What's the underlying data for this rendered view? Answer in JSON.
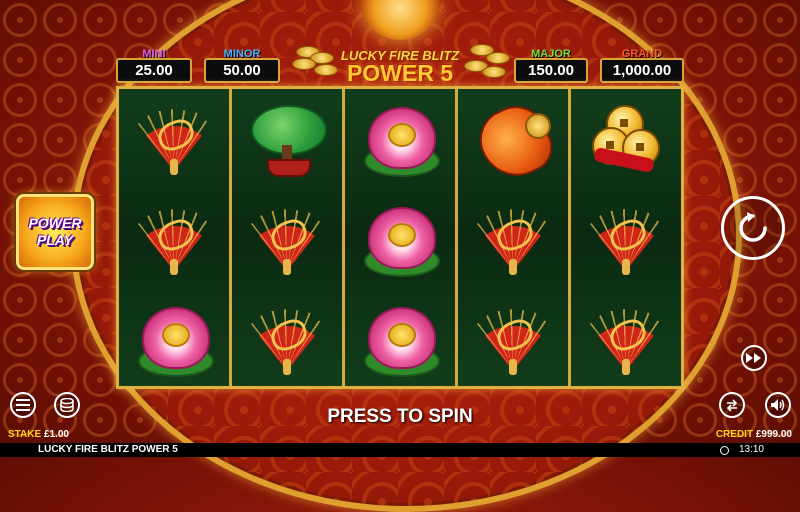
{
  "game": {
    "title": "LUCKY FIRE BLITZ POWER 5",
    "logo_line1": "LUCKY FIRE BLITZ",
    "logo_line2": "POWER 5"
  },
  "jackpots": [
    {
      "name": "MINI",
      "value": "25.00",
      "color": "#e85ae8"
    },
    {
      "name": "MINOR",
      "value": "50.00",
      "color": "#4ab0ff"
    },
    {
      "name": "MAJOR",
      "value": "150.00",
      "color": "#7ae03a"
    },
    {
      "name": "GRAND",
      "value": "1,000.00",
      "color": "#ff5a2a"
    }
  ],
  "reels": [
    [
      "fan",
      "fan",
      "lotus"
    ],
    [
      "money-tree",
      "fan",
      "fan"
    ],
    [
      "lotus",
      "lotus",
      "lotus"
    ],
    [
      "koi-fish",
      "fan",
      "fan"
    ],
    [
      "gold-coins",
      "fan",
      "fan"
    ]
  ],
  "power_play": {
    "line1": "POWER",
    "line2": "PLAY"
  },
  "spin_prompt": "PRESS TO SPIN",
  "stake": {
    "label": "STAKE",
    "value": "£1.00"
  },
  "credit": {
    "label": "CREDIT",
    "value": "£999.00"
  },
  "clock": "13:10",
  "icons": {
    "menu": "menu-icon",
    "coins": "coin-stack-icon",
    "spin": "spin-arrow-icon",
    "turbo": "fast-forward-icon",
    "autoplay": "autoplay-icon",
    "sound": "speaker-icon"
  },
  "colors": {
    "frame_gold": "#e0b040",
    "reel_green": "#0b2a12",
    "accent_yellow": "#ffd21a"
  }
}
